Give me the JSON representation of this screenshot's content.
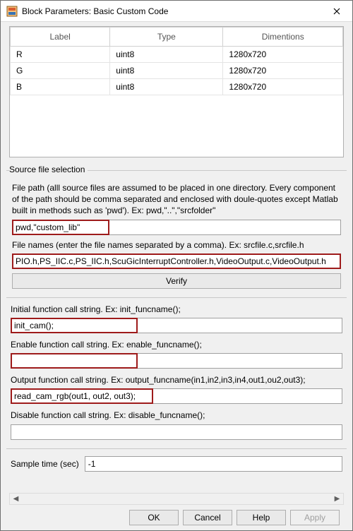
{
  "window": {
    "title": "Block Parameters: Basic Custom Code"
  },
  "table": {
    "headers": {
      "0": "Label",
      "1": "Type",
      "2": "Dimentions"
    },
    "rows": [
      {
        "label": "R",
        "type": "uint8",
        "dim": "1280x720"
      },
      {
        "label": "G",
        "type": "uint8",
        "dim": "1280x720"
      },
      {
        "label": "B",
        "type": "uint8",
        "dim": "1280x720"
      }
    ]
  },
  "source": {
    "title": "Source file selection",
    "filepath_desc": "File path (alll source files are assumed to be placed in one directory. Every component of the path should be comma separated and enclosed with doule-quotes except Matlab built in methods such as 'pwd'). Ex: pwd,\"..\",\"srcfolder\"",
    "filepath_value": "pwd,\"custom_lib\"",
    "filenames_desc": "File names (enter the file names separated by a comma). Ex: srcfile.c,srcfile.h",
    "filenames_value": "PIO.h,PS_IIC.c,PS_IIC.h,ScuGicInterruptController.h,VideoOutput.c,VideoOutput.h",
    "verify_label": "Verify"
  },
  "funcs": {
    "init_desc": "Initial function call string. Ex: init_funcname();",
    "init_value": "init_cam();",
    "enable_desc": "Enable function call string. Ex: enable_funcname();",
    "enable_value": "",
    "output_desc": "Output function call string. Ex: output_funcname(in1,in2,in3,in4,out1,ou2,out3);",
    "output_value": "read_cam_rgb(out1, out2, out3);",
    "disable_desc": "Disable function call string. Ex: disable_funcname();",
    "disable_value": ""
  },
  "sample": {
    "label": "Sample time (sec)",
    "value": "-1"
  },
  "buttons": {
    "ok": "OK",
    "cancel": "Cancel",
    "help": "Help",
    "apply": "Apply"
  }
}
